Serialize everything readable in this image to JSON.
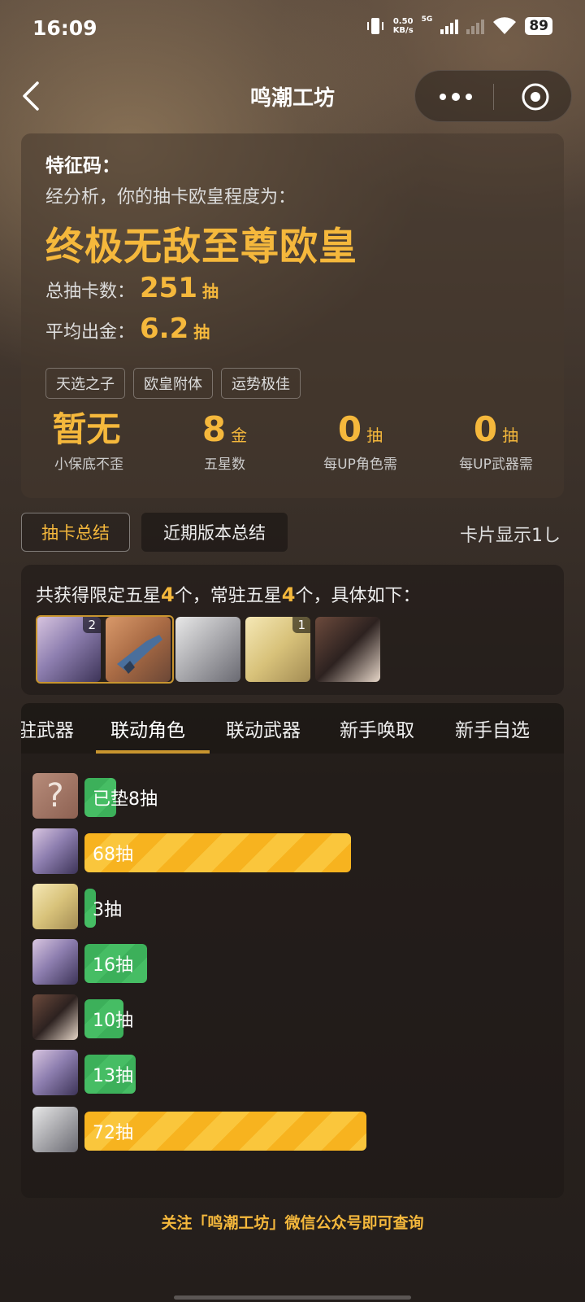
{
  "status": {
    "time": "16:09",
    "net_speed_value": "0.50",
    "net_speed_unit": "KB/s",
    "network": "5G",
    "battery": "89"
  },
  "nav": {
    "title": "鸣潮工坊"
  },
  "summary": {
    "feature_code_label": "特征码：",
    "analysis_text": "经分析，你的抽卡欧皇程度为：",
    "rank": "终极无敌至尊欧皇",
    "total_label": "总抽卡数：",
    "total_value": "251",
    "total_unit": "抽",
    "avg_label": "平均出金：",
    "avg_value": "6.2",
    "avg_unit": "抽",
    "tags": [
      "天选之子",
      "欧皇附体",
      "运势极佳"
    ],
    "metrics": [
      {
        "value": "暂无",
        "unit": "",
        "label": "小保底不歪"
      },
      {
        "value": "8",
        "unit": "金",
        "label": "五星数"
      },
      {
        "value": "0",
        "unit": "抽",
        "label": "每UP角色需"
      },
      {
        "value": "0",
        "unit": "抽",
        "label": "每UP武器需"
      }
    ]
  },
  "tabs": {
    "summary": "抽卡总结",
    "recent": "近期版本总结",
    "card_display": "卡片显示1し"
  },
  "obtained": {
    "prefix": "共获得限定五星",
    "limited_count": "4",
    "middle": "个，常驻五星",
    "standard_count": "4",
    "suffix": "个，具体如下：",
    "items": [
      {
        "name": "blue-haired-character",
        "count": "2"
      },
      {
        "name": "blaster-weapon",
        "count": ""
      },
      {
        "name": "silver-haired-character",
        "count": ""
      },
      {
        "name": "blonde-character",
        "count": "1"
      },
      {
        "name": "dark-haired-character",
        "count": ""
      }
    ]
  },
  "pool_tabs": [
    "驻武器",
    "联动角色",
    "联动武器",
    "新手唤取",
    "新手自选"
  ],
  "pool_active": "联动角色",
  "history": [
    {
      "avatar": "unknown",
      "label": "已垫8抽",
      "pulls": 8,
      "color": "green"
    },
    {
      "avatar": "blue-haired",
      "label": "68抽",
      "pulls": 68,
      "color": "gold"
    },
    {
      "avatar": "blonde",
      "label": "3抽",
      "pulls": 3,
      "color": "green"
    },
    {
      "avatar": "blue-haired",
      "label": "16抽",
      "pulls": 16,
      "color": "green"
    },
    {
      "avatar": "dark-haired",
      "label": "10抽",
      "pulls": 10,
      "color": "green"
    },
    {
      "avatar": "blue-haired",
      "label": "13抽",
      "pulls": 13,
      "color": "green"
    },
    {
      "avatar": "silver-haired",
      "label": "72抽",
      "pulls": 72,
      "color": "gold"
    }
  ],
  "unknown_glyph": "?",
  "footer": "关注「鸣潮工坊」微信公众号即可查询",
  "colors": {
    "accent_gold": "#f5b83c",
    "bar_green": "#3cb05a",
    "bar_gold": "#f7b31f"
  }
}
